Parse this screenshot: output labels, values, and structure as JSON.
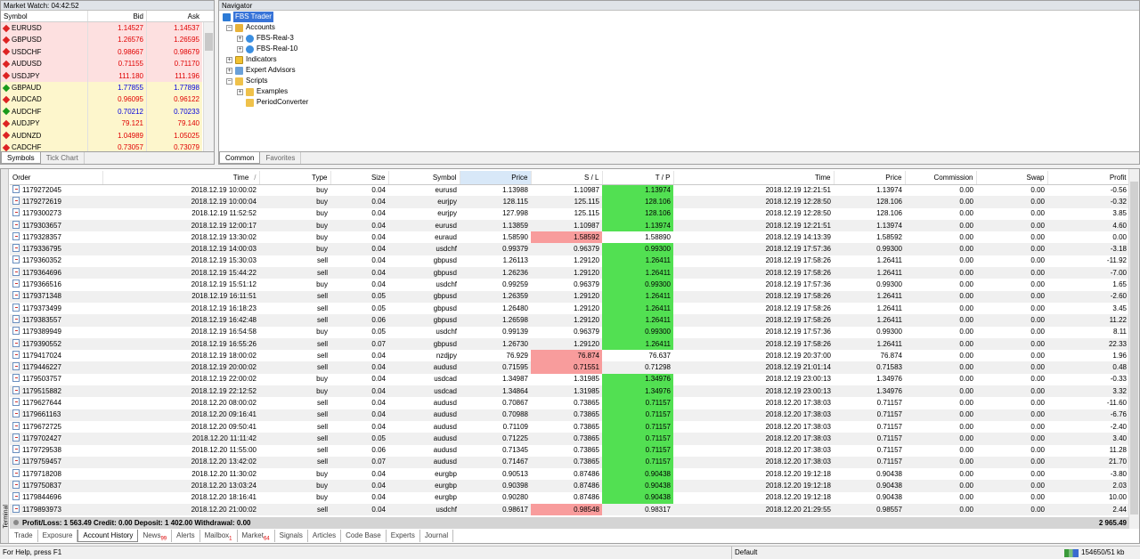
{
  "market_watch": {
    "title": "Market Watch: 04:42:52",
    "headers": {
      "symbol": "Symbol",
      "bid": "Bid",
      "ask": "Ask"
    },
    "rows": [
      {
        "symbol": "EURUSD",
        "bid": "1.14527",
        "ask": "1.14537",
        "dir": "dn",
        "bg": "red",
        "color": "red"
      },
      {
        "symbol": "GBPUSD",
        "bid": "1.26576",
        "ask": "1.26595",
        "dir": "dn",
        "bg": "red",
        "color": "red"
      },
      {
        "symbol": "USDCHF",
        "bid": "0.98667",
        "ask": "0.98679",
        "dir": "dn",
        "bg": "red",
        "color": "red"
      },
      {
        "symbol": "AUDUSD",
        "bid": "0.71155",
        "ask": "0.71170",
        "dir": "dn",
        "bg": "red",
        "color": "red"
      },
      {
        "symbol": "USDJPY",
        "bid": "111.180",
        "ask": "111.196",
        "dir": "dn",
        "bg": "red",
        "color": "red"
      },
      {
        "symbol": "GBPAUD",
        "bid": "1.77855",
        "ask": "1.77898",
        "dir": "up",
        "bg": "yel",
        "color": "blue"
      },
      {
        "symbol": "AUDCAD",
        "bid": "0.96095",
        "ask": "0.96122",
        "dir": "dn",
        "bg": "yel",
        "color": "red"
      },
      {
        "symbol": "AUDCHF",
        "bid": "0.70212",
        "ask": "0.70233",
        "dir": "up",
        "bg": "yel",
        "color": "blue"
      },
      {
        "symbol": "AUDJPY",
        "bid": "79.121",
        "ask": "79.140",
        "dir": "dn",
        "bg": "yel",
        "color": "red"
      },
      {
        "symbol": "AUDNZD",
        "bid": "1.04989",
        "ask": "1.05025",
        "dir": "dn",
        "bg": "yel",
        "color": "red"
      },
      {
        "symbol": "CADCHF",
        "bid": "0.73057",
        "ask": "0.73079",
        "dir": "dn",
        "bg": "yel",
        "color": "red"
      }
    ],
    "tabs": [
      "Symbols",
      "Tick Chart"
    ]
  },
  "navigator": {
    "title": "Navigator",
    "root": "FBS Trader",
    "accounts": "Accounts",
    "account_items": [
      "FBS-Real-3",
      "FBS-Real-10"
    ],
    "indicators": "Indicators",
    "experts": "Expert Advisors",
    "scripts": "Scripts",
    "script_items": [
      "Examples",
      "PeriodConverter"
    ],
    "tabs": [
      "Common",
      "Favorites"
    ]
  },
  "terminal": {
    "side_label": "Terminal",
    "headers": [
      "Order",
      "Time",
      "Type",
      "Size",
      "Symbol",
      "Price",
      "S / L",
      "T / P",
      "Time",
      "Price",
      "Commission",
      "Swap",
      "Profit"
    ],
    "sort_indicator": "/",
    "rows": [
      [
        "1179272045",
        "2018.12.19 10:00:02",
        "buy",
        "0.04",
        "eurusd",
        "1.13988",
        "1.10987",
        "1.13974",
        "2018.12.19 12:21:51",
        "1.13974",
        "0.00",
        "0.00",
        "-0.56",
        "tp"
      ],
      [
        "1179272619",
        "2018.12.19 10:00:04",
        "buy",
        "0.04",
        "eurjpy",
        "128.115",
        "125.115",
        "128.106",
        "2018.12.19 12:28:50",
        "128.106",
        "0.00",
        "0.00",
        "-0.32",
        "tp"
      ],
      [
        "1179300273",
        "2018.12.19 11:52:52",
        "buy",
        "0.04",
        "eurjpy",
        "127.998",
        "125.115",
        "128.106",
        "2018.12.19 12:28:50",
        "128.106",
        "0.00",
        "0.00",
        "3.85",
        "tp"
      ],
      [
        "1179303657",
        "2018.12.19 12:00:17",
        "buy",
        "0.04",
        "eurusd",
        "1.13859",
        "1.10987",
        "1.13974",
        "2018.12.19 12:21:51",
        "1.13974",
        "0.00",
        "0.00",
        "4.60",
        "tp"
      ],
      [
        "1179328357",
        "2018.12.19 13:30:02",
        "buy",
        "0.04",
        "euraud",
        "1.58590",
        "1.58592",
        "1.58890",
        "2018.12.19 14:13:39",
        "1.58592",
        "0.00",
        "0.00",
        "0.00",
        "sl"
      ],
      [
        "1179336795",
        "2018.12.19 14:00:03",
        "buy",
        "0.04",
        "usdchf",
        "0.99379",
        "0.96379",
        "0.99300",
        "2018.12.19 17:57:36",
        "0.99300",
        "0.00",
        "0.00",
        "-3.18",
        "tp"
      ],
      [
        "1179360352",
        "2018.12.19 15:30:03",
        "sell",
        "0.04",
        "gbpusd",
        "1.26113",
        "1.29120",
        "1.26411",
        "2018.12.19 17:58:26",
        "1.26411",
        "0.00",
        "0.00",
        "-11.92",
        "tp"
      ],
      [
        "1179364696",
        "2018.12.19 15:44:22",
        "sell",
        "0.04",
        "gbpusd",
        "1.26236",
        "1.29120",
        "1.26411",
        "2018.12.19 17:58:26",
        "1.26411",
        "0.00",
        "0.00",
        "-7.00",
        "tp"
      ],
      [
        "1179366516",
        "2018.12.19 15:51:12",
        "buy",
        "0.04",
        "usdchf",
        "0.99259",
        "0.96379",
        "0.99300",
        "2018.12.19 17:57:36",
        "0.99300",
        "0.00",
        "0.00",
        "1.65",
        "tp"
      ],
      [
        "1179371348",
        "2018.12.19 16:11:51",
        "sell",
        "0.05",
        "gbpusd",
        "1.26359",
        "1.29120",
        "1.26411",
        "2018.12.19 17:58:26",
        "1.26411",
        "0.00",
        "0.00",
        "-2.60",
        "tp"
      ],
      [
        "1179373499",
        "2018.12.19 16:18:23",
        "sell",
        "0.05",
        "gbpusd",
        "1.26480",
        "1.29120",
        "1.26411",
        "2018.12.19 17:58:26",
        "1.26411",
        "0.00",
        "0.00",
        "3.45",
        "tp"
      ],
      [
        "1179383557",
        "2018.12.19 16:42:48",
        "sell",
        "0.06",
        "gbpusd",
        "1.26598",
        "1.29120",
        "1.26411",
        "2018.12.19 17:58:26",
        "1.26411",
        "0.00",
        "0.00",
        "11.22",
        "tp"
      ],
      [
        "1179389949",
        "2018.12.19 16:54:58",
        "buy",
        "0.05",
        "usdchf",
        "0.99139",
        "0.96379",
        "0.99300",
        "2018.12.19 17:57:36",
        "0.99300",
        "0.00",
        "0.00",
        "8.11",
        "tp"
      ],
      [
        "1179390552",
        "2018.12.19 16:55:26",
        "sell",
        "0.07",
        "gbpusd",
        "1.26730",
        "1.29120",
        "1.26411",
        "2018.12.19 17:58:26",
        "1.26411",
        "0.00",
        "0.00",
        "22.33",
        "tp"
      ],
      [
        "1179417024",
        "2018.12.19 18:00:02",
        "sell",
        "0.04",
        "nzdjpy",
        "76.929",
        "76.874",
        "76.637",
        "2018.12.19 20:37:00",
        "76.874",
        "0.00",
        "0.00",
        "1.96",
        "sl"
      ],
      [
        "1179446227",
        "2018.12.19 20:00:02",
        "sell",
        "0.04",
        "audusd",
        "0.71595",
        "0.71551",
        "0.71298",
        "2018.12.19 21:01:14",
        "0.71583",
        "0.00",
        "0.00",
        "0.48",
        "sl"
      ],
      [
        "1179503757",
        "2018.12.19 22:00:02",
        "buy",
        "0.04",
        "usdcad",
        "1.34987",
        "1.31985",
        "1.34976",
        "2018.12.19 23:00:13",
        "1.34976",
        "0.00",
        "0.00",
        "-0.33",
        "tp"
      ],
      [
        "1179515882",
        "2018.12.19 22:12:52",
        "buy",
        "0.04",
        "usdcad",
        "1.34864",
        "1.31985",
        "1.34976",
        "2018.12.19 23:00:13",
        "1.34976",
        "0.00",
        "0.00",
        "3.32",
        "tp"
      ],
      [
        "1179627644",
        "2018.12.20 08:00:02",
        "sell",
        "0.04",
        "audusd",
        "0.70867",
        "0.73865",
        "0.71157",
        "2018.12.20 17:38:03",
        "0.71157",
        "0.00",
        "0.00",
        "-11.60",
        "tp"
      ],
      [
        "1179661163",
        "2018.12.20 09:16:41",
        "sell",
        "0.04",
        "audusd",
        "0.70988",
        "0.73865",
        "0.71157",
        "2018.12.20 17:38:03",
        "0.71157",
        "0.00",
        "0.00",
        "-6.76",
        "tp"
      ],
      [
        "1179672725",
        "2018.12.20 09:50:41",
        "sell",
        "0.04",
        "audusd",
        "0.71109",
        "0.73865",
        "0.71157",
        "2018.12.20 17:38:03",
        "0.71157",
        "0.00",
        "0.00",
        "-2.40",
        "tp"
      ],
      [
        "1179702427",
        "2018.12.20 11:11:42",
        "sell",
        "0.05",
        "audusd",
        "0.71225",
        "0.73865",
        "0.71157",
        "2018.12.20 17:38:03",
        "0.71157",
        "0.00",
        "0.00",
        "3.40",
        "tp"
      ],
      [
        "1179729538",
        "2018.12.20 11:55:00",
        "sell",
        "0.06",
        "audusd",
        "0.71345",
        "0.73865",
        "0.71157",
        "2018.12.20 17:38:03",
        "0.71157",
        "0.00",
        "0.00",
        "11.28",
        "tp"
      ],
      [
        "1179759457",
        "2018.12.20 13:42:02",
        "sell",
        "0.07",
        "audusd",
        "0.71467",
        "0.73865",
        "0.71157",
        "2018.12.20 17:38:03",
        "0.71157",
        "0.00",
        "0.00",
        "21.70",
        "tp"
      ],
      [
        "1179718208",
        "2018.12.20 11:30:02",
        "buy",
        "0.04",
        "eurgbp",
        "0.90513",
        "0.87486",
        "0.90438",
        "2018.12.20 19:12:18",
        "0.90438",
        "0.00",
        "0.00",
        "-3.80",
        "tp"
      ],
      [
        "1179750837",
        "2018.12.20 13:03:24",
        "buy",
        "0.04",
        "eurgbp",
        "0.90398",
        "0.87486",
        "0.90438",
        "2018.12.20 19:12:18",
        "0.90438",
        "0.00",
        "0.00",
        "2.03",
        "tp"
      ],
      [
        "1179844696",
        "2018.12.20 18:16:41",
        "buy",
        "0.04",
        "eurgbp",
        "0.90280",
        "0.87486",
        "0.90438",
        "2018.12.20 19:12:18",
        "0.90438",
        "0.00",
        "0.00",
        "10.00",
        "tp"
      ],
      [
        "1179893973",
        "2018.12.20 21:00:02",
        "sell",
        "0.04",
        "usdchf",
        "0.98617",
        "0.98548",
        "0.98317",
        "2018.12.20 21:29:55",
        "0.98557",
        "0.00",
        "0.00",
        "2.44",
        "sl"
      ]
    ],
    "summary": "Profit/Loss: 1 563.49  Credit: 0.00  Deposit: 1 402.00  Withdrawal: 0.00",
    "total": "2 965.49",
    "tabs": [
      {
        "label": "Trade"
      },
      {
        "label": "Exposure"
      },
      {
        "label": "Account History",
        "active": true
      },
      {
        "label": "News",
        "badge": "99"
      },
      {
        "label": "Alerts"
      },
      {
        "label": "Mailbox",
        "badge": "1"
      },
      {
        "label": "Market",
        "badge": "64"
      },
      {
        "label": "Signals"
      },
      {
        "label": "Articles"
      },
      {
        "label": "Code Base"
      },
      {
        "label": "Experts"
      },
      {
        "label": "Journal"
      }
    ]
  },
  "status_bar": {
    "help": "For Help, press F1",
    "profile": "Default",
    "connection": "154650/51 kb"
  }
}
